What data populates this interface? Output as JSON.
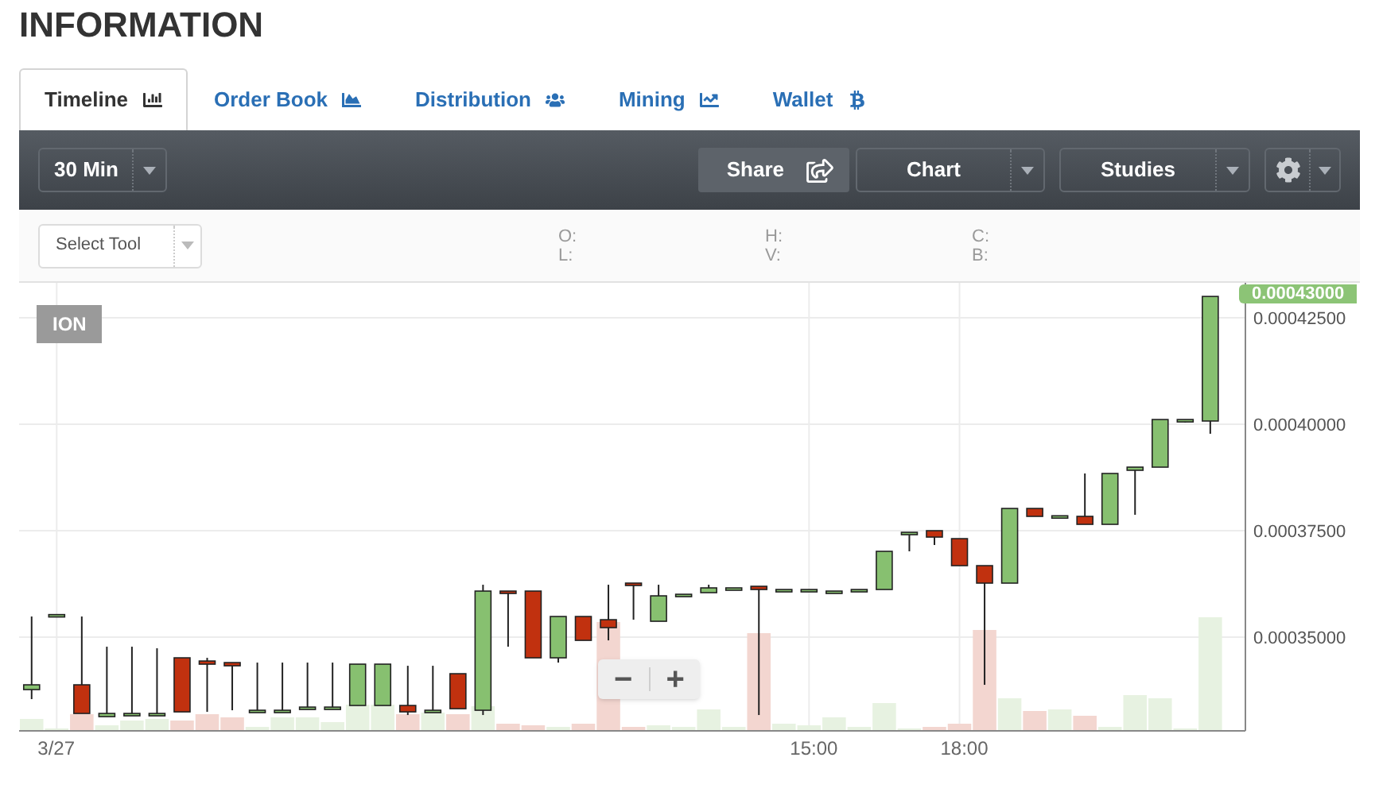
{
  "title": "INFORMATION",
  "tabs": [
    {
      "label": "Timeline",
      "selected": true
    },
    {
      "label": "Order Book",
      "selected": false
    },
    {
      "label": "Distribution",
      "selected": false
    },
    {
      "label": "Mining",
      "selected": false
    },
    {
      "label": "Wallet",
      "selected": false
    }
  ],
  "toolbar": {
    "interval": "30 Min",
    "share": "Share",
    "chart": "Chart",
    "studies": "Studies"
  },
  "select_tool": {
    "placeholder": "Select Tool"
  },
  "ohlc": [
    [
      "O:",
      "L:"
    ],
    [
      "H:",
      "V:"
    ],
    [
      "C:",
      "B:"
    ]
  ],
  "chart": {
    "symbol": "ION",
    "last_price": "0.00043000",
    "zoom_out": "−",
    "zoom_in": "+",
    "chart_data": {
      "type": "candlestick",
      "x": [
        -0.5,
        0,
        0.5,
        1,
        1.5,
        2,
        2.5,
        3,
        3.5,
        4,
        4.5,
        5,
        5.5,
        6,
        6.5,
        7,
        7.5,
        8,
        8.5,
        9,
        9.5,
        10,
        10.5,
        11,
        11.5,
        12,
        12.5,
        13,
        13.5,
        14,
        14.5,
        15,
        15.5,
        16,
        16.5,
        17,
        17.5,
        18,
        18.5,
        19,
        19.5,
        20,
        20.5,
        21,
        21.5,
        22,
        22.5,
        23
      ],
      "grid": true,
      "xlim": [
        -0.75,
        23.7
      ],
      "ylim": [
        0.000328,
        0.0004332
      ],
      "xticks": [
        {
          "value": 0,
          "label": "3/27"
        },
        {
          "value": 15,
          "label": "15:00"
        },
        {
          "value": 18,
          "label": "18:00"
        }
      ],
      "yticks": [
        {
          "value": 0.00035,
          "label": "0.00035000"
        },
        {
          "value": 0.000375,
          "label": "0.00037500"
        },
        {
          "value": 0.0004,
          "label": "0.00040000"
        },
        {
          "value": 0.000425,
          "label": "0.00042500"
        }
      ],
      "ohlc": [
        [
          0.00033769,
          0.00035485,
          0.00033545,
          0.00033881
        ],
        [
          0.00035485,
          0.0003553,
          0.00035485,
          0.0003553
        ],
        [
          0.00033881,
          0.00035485,
          0.00033209,
          0.00033209
        ],
        [
          0.00033134,
          0.00034776,
          0.00033134,
          0.00033209
        ],
        [
          0.00033172,
          0.00034776,
          0.00033172,
          0.00033209
        ],
        [
          0.00033172,
          0.00034739,
          0.00033172,
          0.00033209
        ],
        [
          0.00034515,
          0.00034515,
          0.00033246,
          0.00033246
        ],
        [
          0.0003444,
          0.00034515,
          0.00033246,
          0.00034366
        ],
        [
          0.00034403,
          0.00034403,
          0.00033284,
          0.00034328
        ],
        [
          0.00033246,
          0.00034403,
          0.00033246,
          0.00033284
        ],
        [
          0.00033246,
          0.00034403,
          0.00033246,
          0.00033284
        ],
        [
          0.00033321,
          0.00034403,
          0.00033321,
          0.00033358
        ],
        [
          0.00033321,
          0.00034403,
          0.00033321,
          0.00033358
        ],
        [
          0.00033396,
          0.00034366,
          0.00033396,
          0.00034366
        ],
        [
          0.00033396,
          0.00034366,
          0.00033396,
          0.00034366
        ],
        [
          0.00033396,
          0.00034328,
          0.00033172,
          0.00033246
        ],
        [
          0.00033246,
          0.00034328,
          0.00033246,
          0.00033284
        ],
        [
          0.00034142,
          0.00034142,
          0.00033321,
          0.00033321
        ],
        [
          0.00033284,
          0.00036231,
          0.00033172,
          0.00036082
        ],
        [
          0.00036082,
          0.00036082,
          0.00034776,
          0.00036045
        ],
        [
          0.00036082,
          0.00036082,
          0.00034515,
          0.00034515
        ],
        [
          0.00034515,
          0.00035485,
          0.00034403,
          0.00035485
        ],
        [
          0.00035485,
          0.00035485,
          0.00034925,
          0.00034925
        ],
        [
          0.0003541,
          0.00036231,
          0.00034925,
          0.00035224
        ],
        [
          0.00036269,
          0.00036269,
          0.0003541,
          0.00036231
        ],
        [
          0.00035373,
          0.00036231,
          0.00035373,
          0.0003597
        ],
        [
          0.0003597,
          0.00036007,
          0.0003597,
          0.00036007
        ],
        [
          0.00036045,
          0.00036231,
          0.00036045,
          0.00036157
        ],
        [
          0.00036119,
          0.00036157,
          0.00036119,
          0.00036157
        ],
        [
          0.00036194,
          0.00036194,
          0.00033172,
          0.00036119
        ],
        [
          0.00036082,
          0.00036119,
          0.00036082,
          0.00036119
        ],
        [
          0.0003611,
          0.00036119,
          0.0003611,
          0.00036119
        ],
        [
          0.00036045,
          0.00036082,
          0.00036045,
          0.00036082
        ],
        [
          0.00036082,
          0.00036119,
          0.00036082,
          0.00036119
        ],
        [
          0.00036119,
          0.00037015,
          0.00036119,
          0.00037015
        ],
        [
          0.00037425,
          0.00037462,
          0.00037015,
          0.00037462
        ],
        [
          0.000375,
          0.000375,
          0.00037164,
          0.0003735
        ],
        [
          0.00037313,
          0.00037313,
          0.00036679,
          0.00036679
        ],
        [
          0.00036679,
          0.00036679,
          0.00033881,
          0.00036269
        ],
        [
          0.00036269,
          0.00038022,
          0.00036269,
          0.00038022
        ],
        [
          0.00038022,
          0.00038022,
          0.00037836,
          0.00037836
        ],
        [
          0.00037836,
          0.0003785,
          0.00037836,
          0.0003785
        ],
        [
          0.00037836,
          0.00038843,
          0.00037649,
          0.00037649
        ],
        [
          0.00037649,
          0.00038843,
          0.00037649,
          0.00038843
        ],
        [
          0.00038918,
          0.00038992,
          0.00037873,
          0.00038992
        ],
        [
          0.00038992,
          0.0004011,
          0.00038992,
          0.0004011
        ],
        [
          0.00040075,
          0.0004011,
          0.00040037,
          0.0004011
        ],
        [
          0.00040075,
          0.00043,
          0.00039776,
          0.00043
        ]
      ]
    }
  }
}
